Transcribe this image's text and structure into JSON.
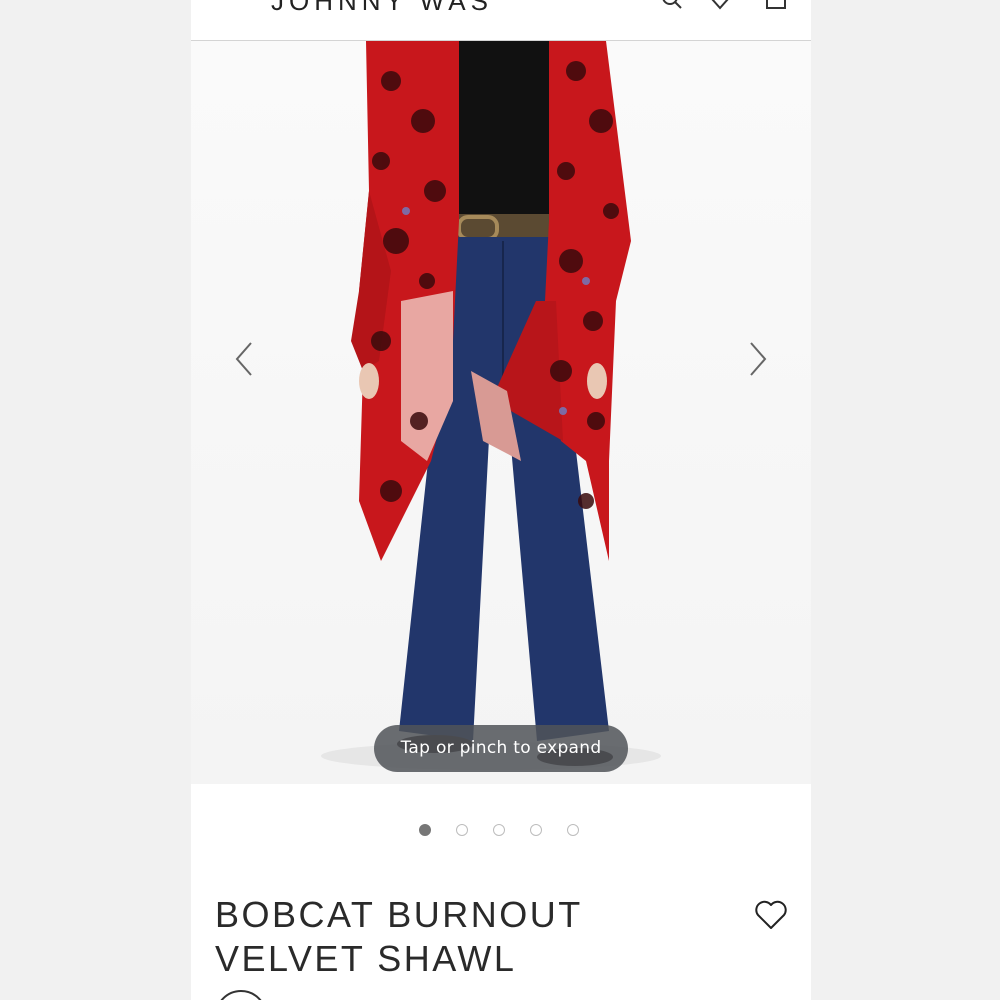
{
  "header": {
    "brand": "JOHNNY WAS",
    "icons": [
      "search-icon",
      "heart-icon",
      "bag-icon"
    ]
  },
  "gallery": {
    "hint": "Tap or pinch to expand",
    "slide_count": 5,
    "active_slide": 1,
    "prev_icon": "chevron-left-icon",
    "next_icon": "chevron-right-icon"
  },
  "product": {
    "title_line1": "BOBCAT BURNOUT",
    "title_line2": "VELVET SHAWL",
    "wishlist_icon": "heart-outline-icon"
  },
  "colors": {
    "shawl_red": "#c8171c",
    "shawl_dark": "#3a0a0c",
    "jeans": "#22366b",
    "top": "#111111",
    "belt": "#5b4a32"
  }
}
